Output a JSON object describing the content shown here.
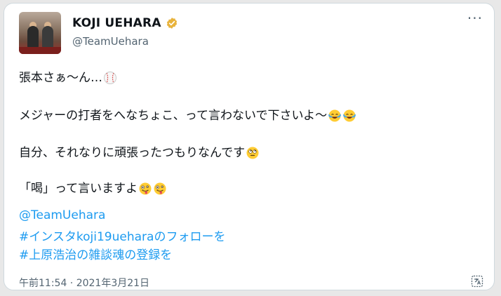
{
  "author": {
    "display_name": "KOJI UEHARA",
    "handle": "@TeamUehara",
    "avatar_icon": "profile-photo"
  },
  "verified_badge_color": "#e8b33c",
  "more_label": "···",
  "tweet": {
    "line1": "張本さぁ〜ん…",
    "line1_emoji": "baseball",
    "line2": "メジャーの打者をへなちょこ、って言わないで下さいよ〜",
    "line2_emoji": "face-with-tears-of-joy",
    "line3": "自分、それなりに頑張ったつもりなんです",
    "line3_emoji": "face-with-rolling-eyes",
    "line4": "「喝」って言いますよ",
    "line4_emoji": "zany-face",
    "links": [
      "@TeamUehara",
      "#インスタkoji19ueharaのフォローを",
      "#上原浩治の雑談魂の登録を"
    ]
  },
  "timestamp": "午前11:54 · 2021年3月21日",
  "link_color": "#1d9bf0"
}
